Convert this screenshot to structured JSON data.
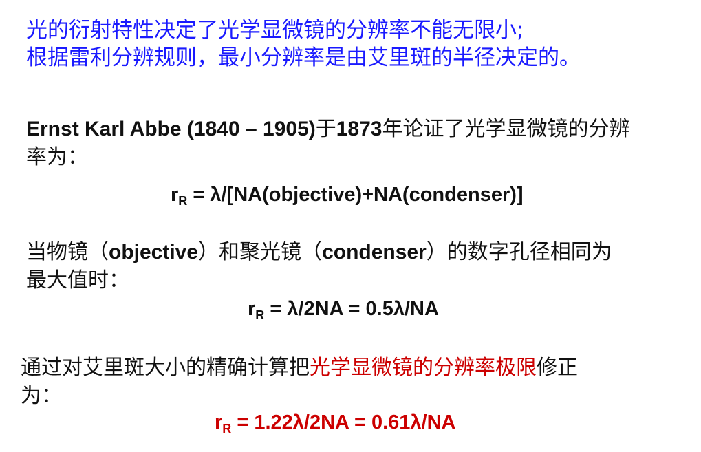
{
  "intro": {
    "line1": "光的衍射特性决定了光学显微镜的分辨率不能无限小;",
    "line2": "根据雷利分辨规则，最小分辨率是由艾里斑的半径决定的。"
  },
  "abbe": {
    "name": "Ernst Karl Abbe (1840 – 1905)",
    "text_a": "于",
    "year": "1873",
    "text_b": "年论证了光学显微镜的分辨",
    "line2": "率为："
  },
  "formula1": {
    "r": "r",
    "sub": "R",
    "rhs": " =  λ/[NA(objective)+NA(condenser)]"
  },
  "condition": {
    "pre": "当物镜（",
    "objective": "objective",
    "mid": "）和聚光镜（",
    "condenser": "condenser",
    "post": "）的数字孔径相同为",
    "line2": "最大值时："
  },
  "formula2": {
    "r": "r",
    "sub": "R",
    "rhs": " =  λ/2NA = 0.5λ/NA"
  },
  "correction": {
    "pre": "通过对艾里斑大小的精确计算把",
    "highlight": "光学显微镜的分辨率极限",
    "post": "修正",
    "line2": "为："
  },
  "formula3": {
    "r": "r",
    "sub": "R",
    "rhs": " =  1.22λ/2NA = 0.61λ/NA"
  },
  "colors": {
    "intro": "#1a1aff",
    "highlight": "#cc0000",
    "text": "#111111",
    "background": "#ffffff"
  }
}
